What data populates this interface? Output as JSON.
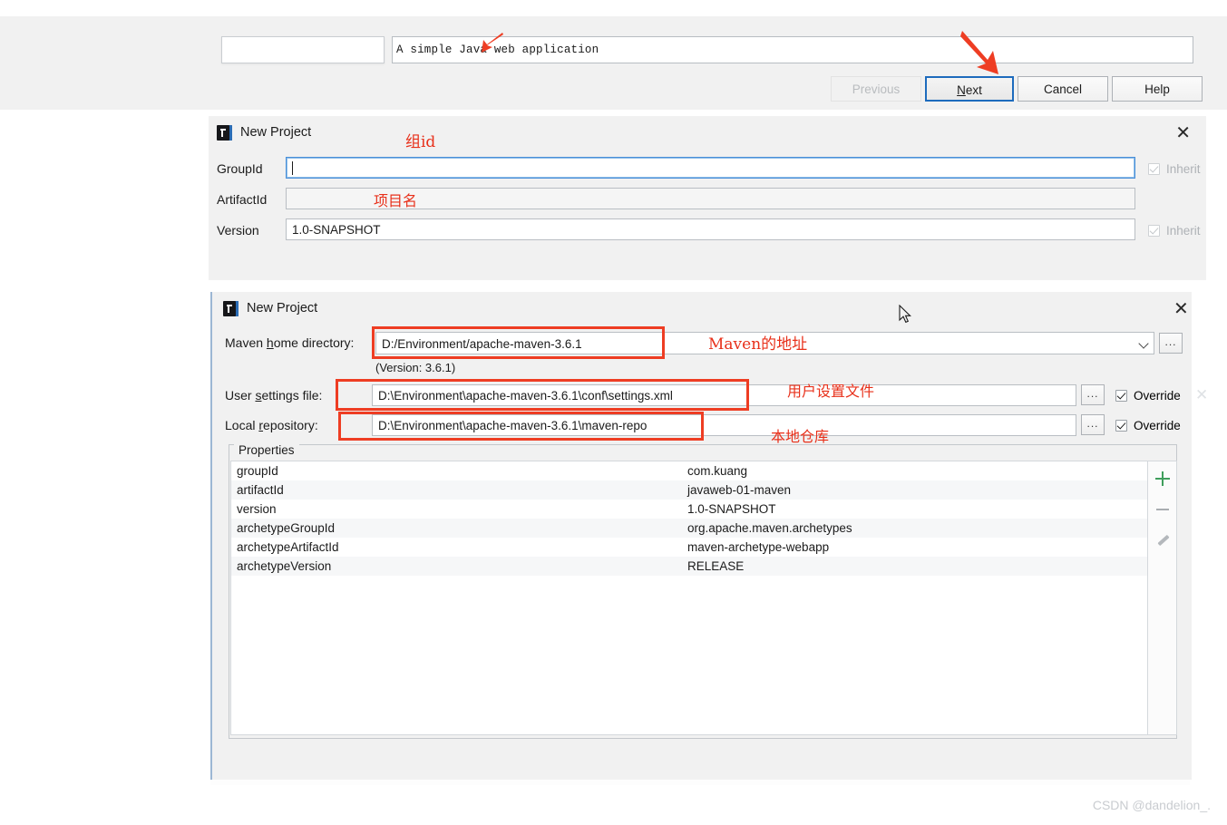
{
  "wizard": {
    "description_value": "A simple Java web application",
    "left_input_value": "",
    "buttons": {
      "previous": "Previous",
      "next_prefix": "",
      "next_mnemonic": "N",
      "next_suffix": "ext",
      "cancel": "Cancel",
      "help": "Help"
    }
  },
  "coordinates_dialog": {
    "title": "New Project",
    "close_label": "✕",
    "rows": [
      {
        "label": "GroupId",
        "value": "",
        "inherit_label": "Inherit",
        "inherit_checked": true,
        "inherit_enabled": false
      },
      {
        "label": "ArtifactId",
        "value": "",
        "inherit_label": "",
        "inherit_checked": false,
        "inherit_enabled": false
      },
      {
        "label": "Version",
        "value": "1.0-SNAPSHOT",
        "inherit_label": "Inherit",
        "inherit_checked": true,
        "inherit_enabled": false
      }
    ]
  },
  "maven_dialog": {
    "title": "New Project",
    "close_label": "✕",
    "maven_home": {
      "label_prefix": "Maven ",
      "label_mnemonic": "h",
      "label_suffix": "ome directory:",
      "value": "D:/Environment/apache-maven-3.6.1",
      "version_note": "(Version: 3.6.1)",
      "browse_label": "...",
      "dropdown_icon": "chevron-down-icon"
    },
    "user_settings": {
      "label_prefix": "User ",
      "label_mnemonic": "s",
      "label_suffix": "ettings file:",
      "value": "D:\\Environment\\apache-maven-3.6.1\\conf\\settings.xml",
      "browse_label": "...",
      "override_label": "Override",
      "override_checked": true
    },
    "local_repository": {
      "label_prefix": "Local ",
      "label_mnemonic": "r",
      "label_suffix": "epository:",
      "value": "D:\\Environment\\apache-maven-3.6.1\\maven-repo",
      "browse_label": "...",
      "override_label": "Override",
      "override_checked": true
    },
    "properties": {
      "legend": "Properties",
      "rows": [
        {
          "key": "groupId",
          "value": "com.kuang"
        },
        {
          "key": "artifactId",
          "value": "javaweb-01-maven"
        },
        {
          "key": "version",
          "value": "1.0-SNAPSHOT"
        },
        {
          "key": "archetypeGroupId",
          "value": "org.apache.maven.archetypes"
        },
        {
          "key": "archetypeArtifactId",
          "value": "maven-archetype-webapp"
        },
        {
          "key": "archetypeVersion",
          "value": "RELEASE"
        }
      ],
      "toolbar": {
        "add": "add-icon",
        "remove": "remove-icon",
        "edit": "edit-pencil-icon"
      }
    }
  },
  "annotations": {
    "group_id": "组id",
    "project_name": "项目名",
    "maven_address": "Maven的地址",
    "user_settings_file": "用户设置文件",
    "local_repo": "本地仓库",
    "accent_color": "#ee3d23"
  },
  "watermark": "CSDN @dandelion_."
}
